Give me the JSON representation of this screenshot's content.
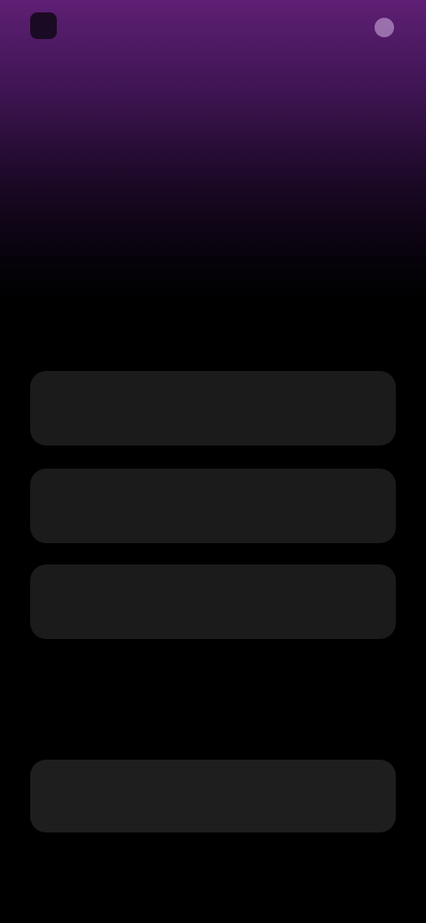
{
  "header": {
    "logo_text": "",
    "top_link_label": ""
  },
  "secondary_link": "",
  "hero": {
    "title": "",
    "subtitle": ""
  },
  "options": [
    {
      "label": ""
    },
    {
      "label": ""
    },
    {
      "label": ""
    }
  ],
  "cta_label": "",
  "colors": {
    "gradient_top": "#5e1f74",
    "background": "#000000",
    "card": "#1b1b1b",
    "accent": "#8a3eaa"
  },
  "icons": {
    "logo": "logo-icon",
    "top_link": "user-icon"
  }
}
